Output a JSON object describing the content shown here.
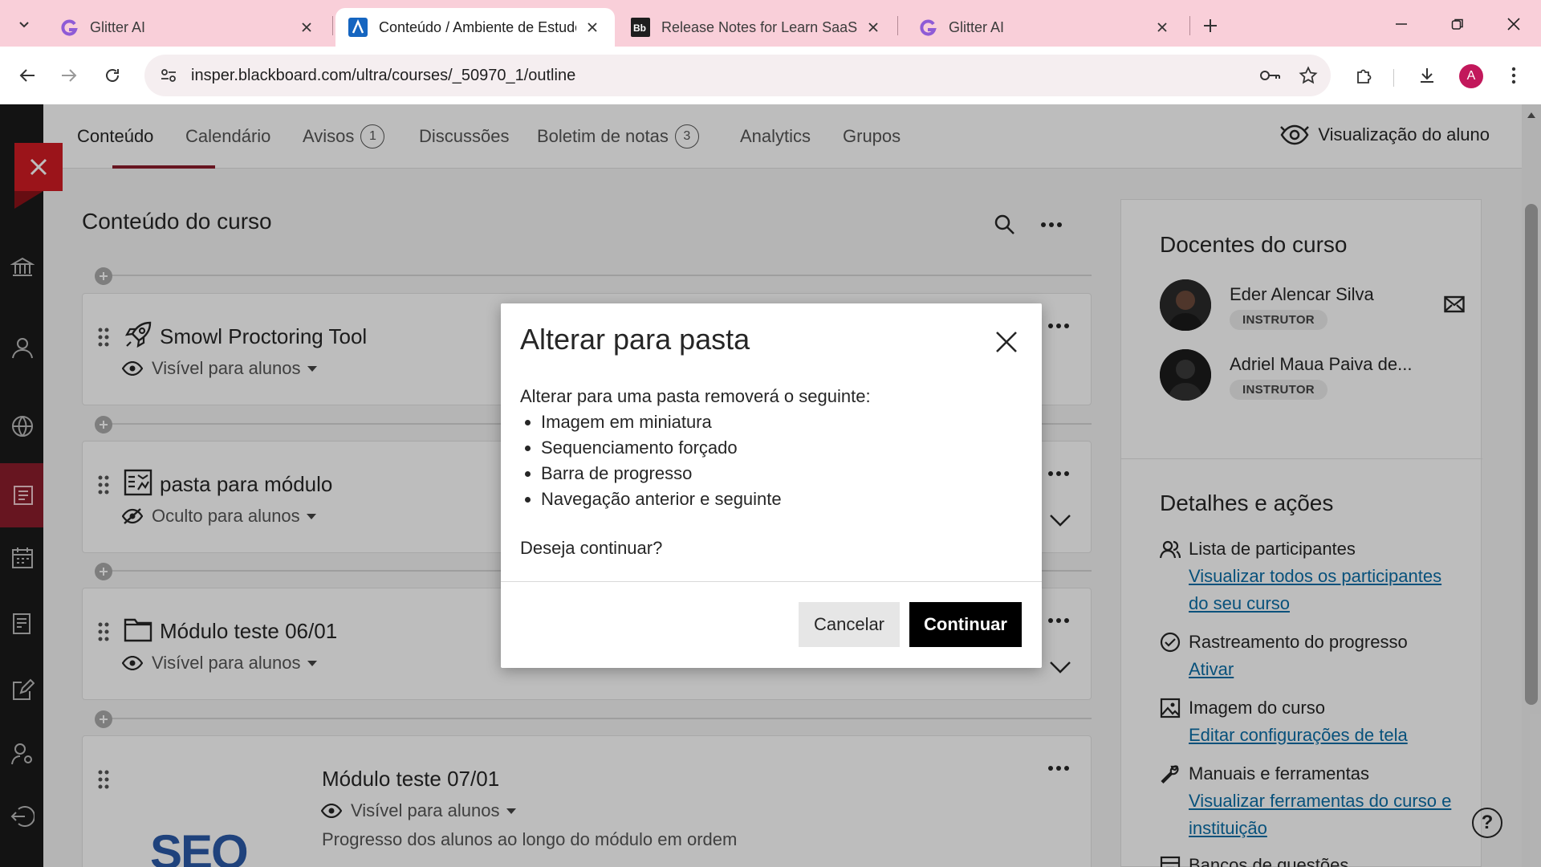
{
  "browser": {
    "tabs": [
      {
        "title": "Glitter AI",
        "favicon": "glitter-g-icon",
        "active": false
      },
      {
        "title": "Conteúdo / Ambiente de Estudo",
        "favicon": "blackboard-a-icon",
        "active": true
      },
      {
        "title": "Release Notes for Learn SaaS | A",
        "favicon": "blackboard-bb-icon",
        "active": false
      },
      {
        "title": "Glitter AI",
        "favicon": "glitter-g-icon",
        "active": false
      }
    ],
    "new_tab": "+",
    "url": "insper.blackboard.com/ultra/courses/_50970_1/outline",
    "avatar_letter": "A",
    "colors": {
      "tabbar": "#f9cfd9",
      "omnibox": "#f5eef0",
      "avatar": "#c2185b"
    }
  },
  "course_nav": {
    "tabs": [
      {
        "label": "Conteúdo",
        "badge": ""
      },
      {
        "label": "Calendário",
        "badge": ""
      },
      {
        "label": "Avisos",
        "badge": "1"
      },
      {
        "label": "Discussões",
        "badge": ""
      },
      {
        "label": "Boletim de notas",
        "badge": "3"
      },
      {
        "label": "Analytics",
        "badge": ""
      },
      {
        "label": "Grupos",
        "badge": ""
      }
    ],
    "student_view": "Visualização do aluno",
    "accent": "#8b1d2c"
  },
  "content": {
    "title": "Conteúdo do curso",
    "items": [
      {
        "title": "Smowl Proctoring Tool",
        "visibility": "Visível para alunos",
        "icon": "rocket-icon"
      },
      {
        "title": "pasta para módulo",
        "visibility": "Oculto para alunos",
        "icon": "module-icon"
      },
      {
        "title": "Módulo teste 06/01",
        "visibility": "Visível para alunos",
        "icon": "folder-icon"
      },
      {
        "title": "Módulo teste 07/01",
        "visibility": "Visível para alunos",
        "description": "Progresso dos alunos ao longo do módulo em ordem",
        "thumbnail_text": "SEO"
      }
    ]
  },
  "sidepanel": {
    "teachers_title": "Docentes do curso",
    "teachers": [
      {
        "name": "Eder Alencar Silva",
        "role": "INSTRUTOR"
      },
      {
        "name": "Adriel Maua Paiva de...",
        "role": "INSTRUTOR"
      }
    ],
    "details_title": "Detalhes e ações",
    "details": [
      {
        "label": "Lista de participantes",
        "link": "Visualizar todos os participantes do seu curso",
        "icon": "participants-icon"
      },
      {
        "label": "Rastreamento do progresso",
        "link": "Ativar",
        "icon": "progress-check-icon"
      },
      {
        "label": "Imagem do curso",
        "link": "Editar configurações de tela",
        "icon": "image-icon"
      },
      {
        "label": "Manuais e ferramentas",
        "link": "Visualizar ferramentas do curso e instituição",
        "icon": "wrench-icon"
      },
      {
        "label": "Bancos de questões",
        "link": "",
        "icon": "bank-icon"
      }
    ],
    "help": "?"
  },
  "modal": {
    "title": "Alterar para pasta",
    "intro": "Alterar para uma pasta removerá o seguinte:",
    "bullets": [
      "Imagem em miniatura",
      "Sequenciamento forçado",
      "Barra de progresso",
      "Navegação anterior e seguinte"
    ],
    "question": "Deseja continuar?",
    "cancel_label": "Cancelar",
    "continue_label": "Continuar"
  }
}
